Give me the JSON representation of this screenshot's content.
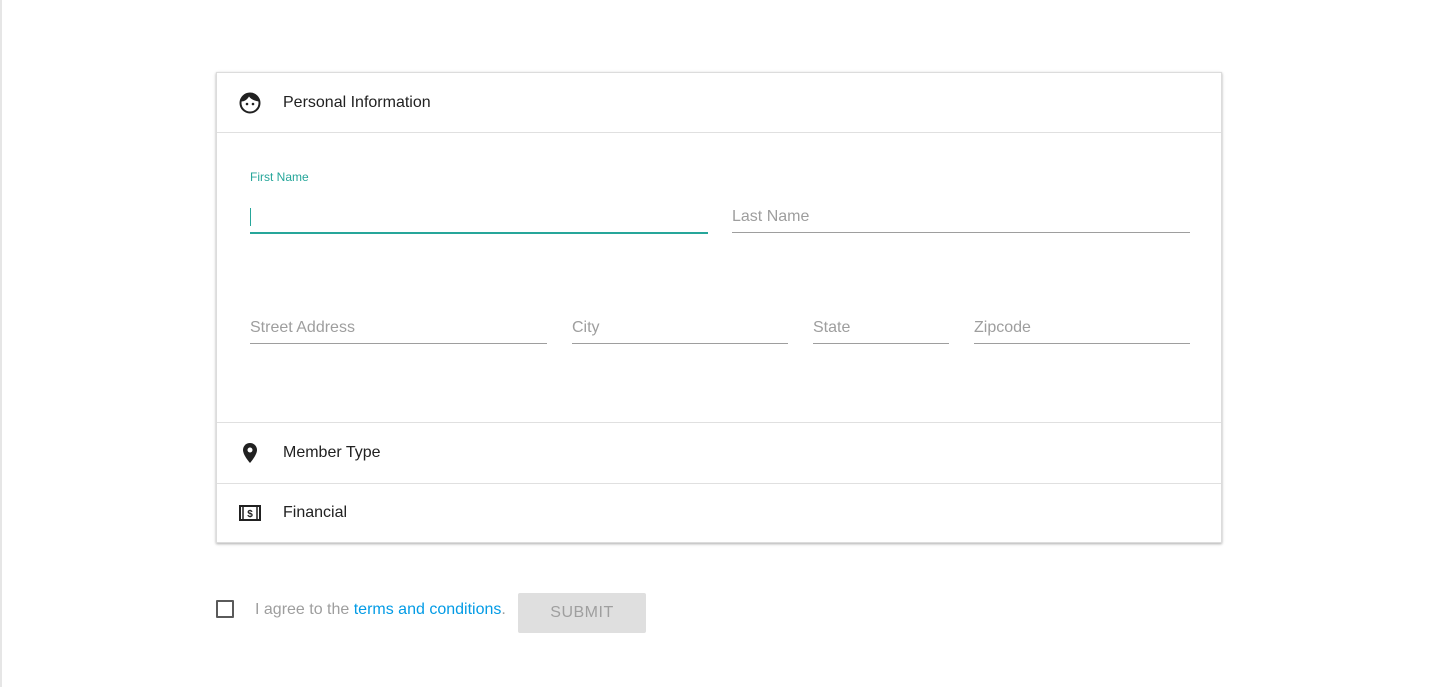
{
  "sections": {
    "personal": {
      "label": "Personal Information",
      "icon": "face-icon"
    },
    "member": {
      "label": "Member Type",
      "icon": "location-pin-icon"
    },
    "financial": {
      "label": "Financial",
      "icon": "dollar-bill-icon"
    }
  },
  "form": {
    "first_name": {
      "label": "First Name",
      "value": ""
    },
    "last_name": {
      "placeholder": "Last Name",
      "value": ""
    },
    "street": {
      "placeholder": "Street Address",
      "value": ""
    },
    "city": {
      "placeholder": "City",
      "value": ""
    },
    "state": {
      "placeholder": "State",
      "value": ""
    },
    "zipcode": {
      "placeholder": "Zipcode",
      "value": ""
    }
  },
  "footer": {
    "agree_prefix": "I agree to the ",
    "terms_link": "terms and conditions",
    "agree_suffix": ".",
    "submit_label": "SUBMIT",
    "checked": false
  },
  "colors": {
    "accent": "#26a69a",
    "link": "#039be5",
    "disabled_bg": "#dfdfdf",
    "disabled_text": "#9f9f9f"
  }
}
